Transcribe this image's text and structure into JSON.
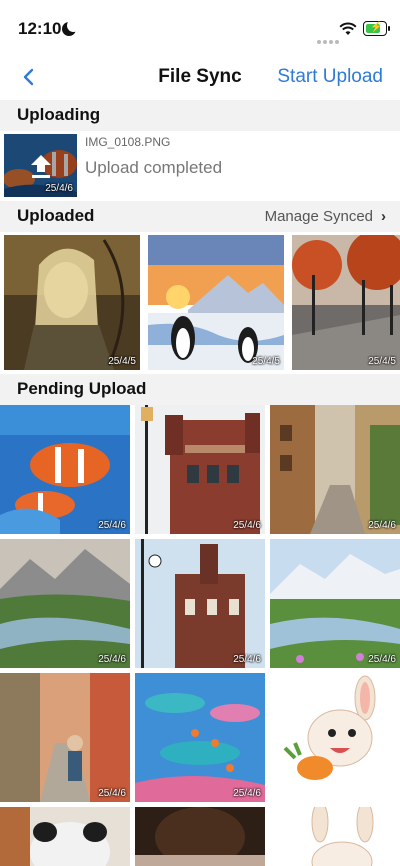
{
  "status_bar": {
    "time": "12:10"
  },
  "nav": {
    "title": "File Sync",
    "action": "Start Upload"
  },
  "uploading": {
    "header": "Uploading",
    "item": {
      "filename": "IMG_0108.PNG",
      "status": "Upload completed",
      "date": "25/4/6"
    }
  },
  "uploaded": {
    "header": "Uploaded",
    "manage": "Manage Synced",
    "dates": [
      "25/4/5",
      "25/4/5",
      "25/4/5"
    ]
  },
  "pending": {
    "header": "Pending Upload",
    "dates": [
      "25/4/6",
      "25/4/6",
      "25/4/6",
      "25/4/6",
      "25/4/6",
      "25/4/6",
      "25/4/6",
      "25/4/6",
      "",
      "",
      "",
      ""
    ]
  },
  "colors": {
    "accent": "#2f7bd6",
    "section_bg": "#f2f2f2"
  }
}
